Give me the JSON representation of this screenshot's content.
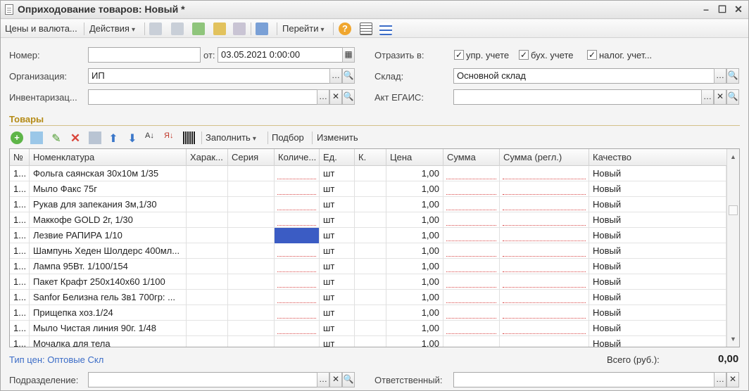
{
  "window": {
    "title": "Оприходование товаров: Новый *",
    "controls": [
      "–",
      "☐",
      "✕"
    ]
  },
  "toolbar": {
    "prices": "Цены и валюта...",
    "actions": "Действия",
    "goto": "Перейти"
  },
  "header": {
    "number_label": "Номер:",
    "number_value": "",
    "date_label": "от:",
    "date_value": "03.05.2021  0:00:00",
    "reflect_label": "Отразить в:",
    "checks": [
      {
        "label": "упр. учете",
        "checked": true
      },
      {
        "label": "бух. учете",
        "checked": true
      },
      {
        "label": "налог. учет...",
        "checked": true
      }
    ],
    "org_label": "Организация:",
    "org_value": "ИП",
    "warehouse_label": "Склад:",
    "warehouse_value": "Основной склад",
    "inventory_label": "Инвентаризац...",
    "inventory_value": "",
    "egais_label": "Акт ЕГАИС:",
    "egais_value": ""
  },
  "goods": {
    "title": "Товары",
    "fill": "Заполнить",
    "pick": "Подбор",
    "change": "Изменить",
    "columns": [
      "№",
      "Номенклатура",
      "Харак...",
      "Серия",
      "Количе...",
      "Ед.",
      "К.",
      "Цена",
      "Сумма",
      "Сумма (регл.)",
      "Качество"
    ],
    "rows": [
      {
        "n": "1...",
        "name": "Фольга саянская 30x10м 1/35",
        "unit": "шт",
        "price": "1,00",
        "quality": "Новый"
      },
      {
        "n": "1...",
        "name": "Мыло Факс 75г",
        "unit": "шт",
        "price": "1,00",
        "quality": "Новый"
      },
      {
        "n": "1...",
        "name": "Рукав для запекания 3м,1/30",
        "unit": "шт",
        "price": "1,00",
        "quality": "Новый"
      },
      {
        "n": "1...",
        "name": "Маккофе GOLD 2г, 1/30",
        "unit": "шт",
        "price": "1,00",
        "quality": "Новый"
      },
      {
        "n": "1...",
        "name": "Лезвие РАПИРА 1/10",
        "unit": "шт",
        "price": "1,00",
        "quality": "Новый"
      },
      {
        "n": "1...",
        "name": "Шампунь Хеден Шолдерс 400мл...",
        "unit": "шт",
        "price": "1,00",
        "quality": "Новый"
      },
      {
        "n": "1...",
        "name": "Лампа 95Вт. 1/100/154",
        "unit": "шт",
        "price": "1,00",
        "quality": "Новый"
      },
      {
        "n": "1...",
        "name": "Пакет Крафт 250x140x60 1/100",
        "unit": "шт",
        "price": "1,00",
        "quality": "Новый"
      },
      {
        "n": "1...",
        "name": "Sanfor Белизна гель 3в1 700гр: ...",
        "unit": "шт",
        "price": "1,00",
        "quality": "Новый"
      },
      {
        "n": "1...",
        "name": "Прищепка хоз.1/24",
        "unit": "шт",
        "price": "1,00",
        "quality": "Новый"
      },
      {
        "n": "1...",
        "name": "Мыло Чистая линия  90г. 1/48",
        "unit": "шт",
        "price": "1,00",
        "quality": "Новый"
      },
      {
        "n": "1...",
        "name": "Мочалка для тела",
        "unit": "шт",
        "price": "1,00",
        "quality": "Новый"
      }
    ]
  },
  "footer": {
    "price_type": "Тип цен: Оптовые Скл",
    "total_label": "Всего (руб.):",
    "total_value": "0,00",
    "dept_label": "Подразделение:",
    "dept_value": "",
    "resp_label": "Ответственный:",
    "resp_value": ""
  },
  "colors": {
    "accent": "#b58b16",
    "link": "#3b6cc7",
    "selection": "#3b5cc4"
  }
}
